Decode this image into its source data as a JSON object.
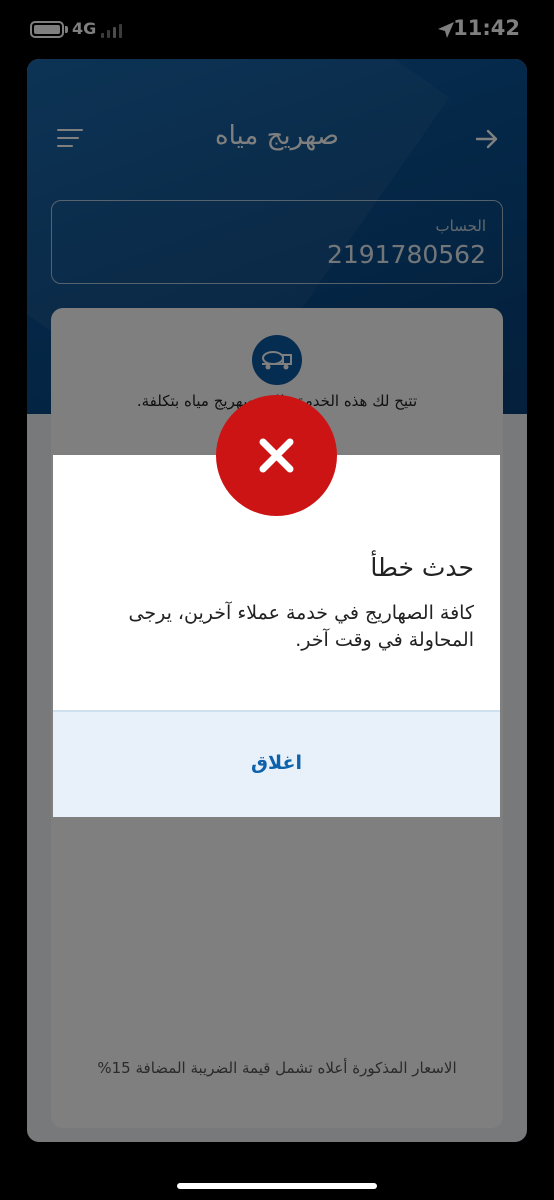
{
  "status_bar": {
    "network": "4G",
    "time": "11:42"
  },
  "header": {
    "title": "صهريج مياه"
  },
  "account": {
    "label": "الحساب",
    "number": "2191780562"
  },
  "service": {
    "description": "تتيح لك هذه الخدمة طلب صهريج مياه بتكلفة.",
    "vat_note": "الاسعار المذكورة أعلاه تشمل قيمة الضريبة المضافة 15%"
  },
  "dialog": {
    "title": "حدث خطأ",
    "message": "كافة الصهاريج في خدمة عملاء آخرين، يرجى المحاولة في وقت آخر.",
    "close_label": "اغلاق"
  },
  "colors": {
    "header_blue": "#0a4f8f",
    "error_red": "#cc1414",
    "link_blue": "#0e61ab"
  }
}
